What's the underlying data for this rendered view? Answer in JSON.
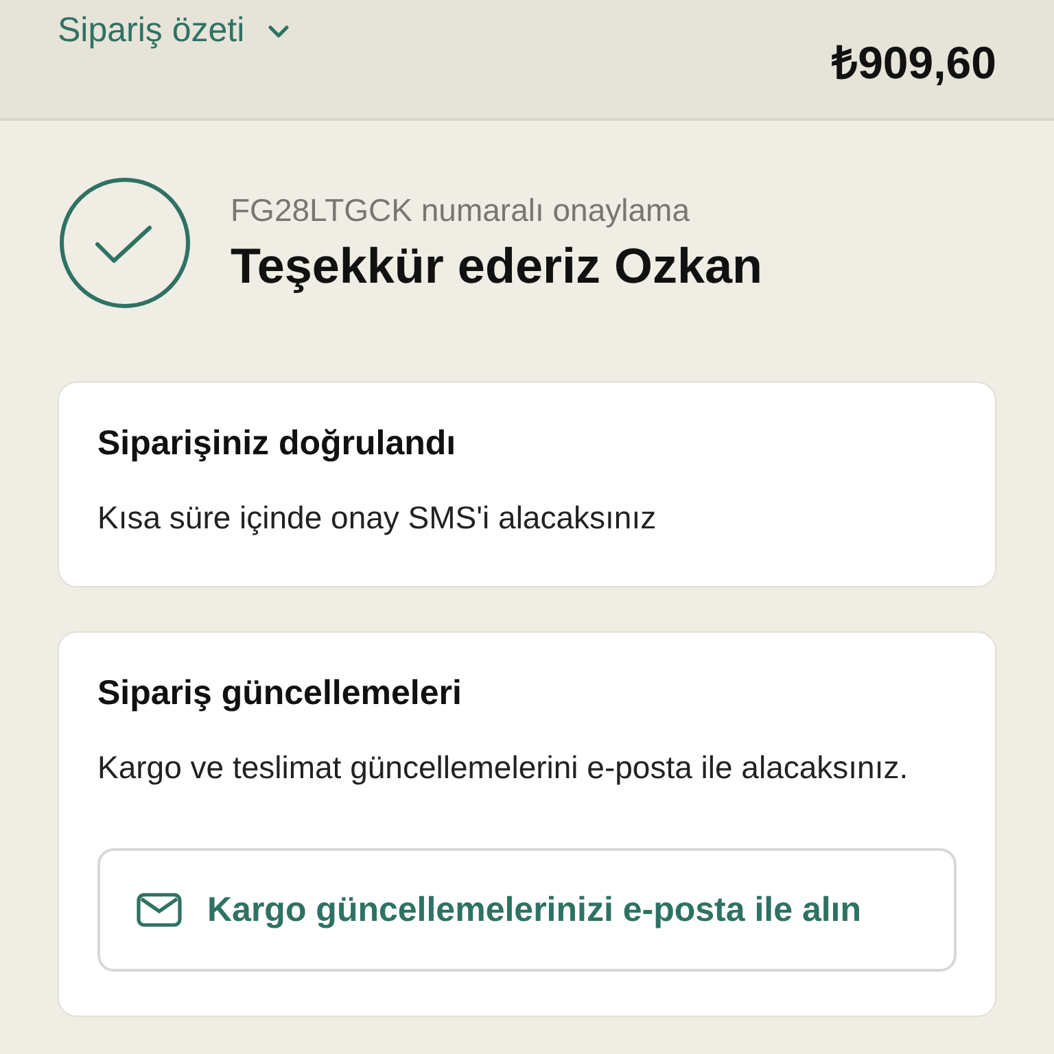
{
  "header": {
    "summary_label": "Sipariş özeti",
    "total": "₺909,60"
  },
  "confirmation": {
    "number_line": "FG28LTGCK numaralı onaylama",
    "title": "Teşekkür ederiz Ozkan"
  },
  "cards": [
    {
      "title": "Siparişiniz doğrulandı",
      "text": "Kısa süre içinde onay SMS'i alacaksınız"
    },
    {
      "title": "Sipariş güncellemeleri",
      "text": "Kargo ve teslimat güncellemelerini e-posta ile alacaksınız.",
      "button": "Kargo güncellemelerinizi e-posta ile alın"
    }
  ]
}
